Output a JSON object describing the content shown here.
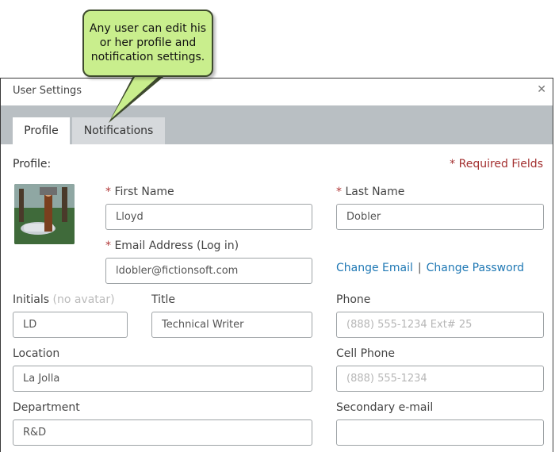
{
  "callout": {
    "text": "Any user can edit his or her profile and notification settings."
  },
  "dialog": {
    "title": "User Settings",
    "close_icon": "close-icon",
    "tabs": [
      {
        "label": "Profile",
        "active": true
      },
      {
        "label": "Notifications",
        "active": false
      }
    ],
    "section_title": "Profile:",
    "required_marker": "*",
    "required_note": "* Required Fields",
    "avatar_icon": "user-photo"
  },
  "form": {
    "first_name": {
      "label": "First Name",
      "value": "Lloyd"
    },
    "last_name": {
      "label": "Last Name",
      "value": "Dobler"
    },
    "email": {
      "label": "Email Address (Log in)",
      "value": "ldobler@fictionsoft.com"
    },
    "change_email": "Change Email",
    "link_separator": "|",
    "change_password": "Change Password",
    "initials": {
      "label": "Initials",
      "hint": "(no avatar)",
      "value": "LD"
    },
    "title": {
      "label": "Title",
      "value": "Technical Writer"
    },
    "phone": {
      "label": "Phone",
      "placeholder": "(888) 555-1234 Ext# 25"
    },
    "location": {
      "label": "Location",
      "value": "La Jolla"
    },
    "cell_phone": {
      "label": "Cell Phone",
      "placeholder": "(888) 555-1234"
    },
    "department": {
      "label": "Department",
      "value": "R&D"
    },
    "secondary_email": {
      "label": "Secondary e-mail",
      "value": ""
    }
  },
  "colors": {
    "required": "#b23a3a",
    "link": "#1f78b4",
    "callout": "#c9ee8d",
    "tabstrip": "#b9bfc3"
  }
}
